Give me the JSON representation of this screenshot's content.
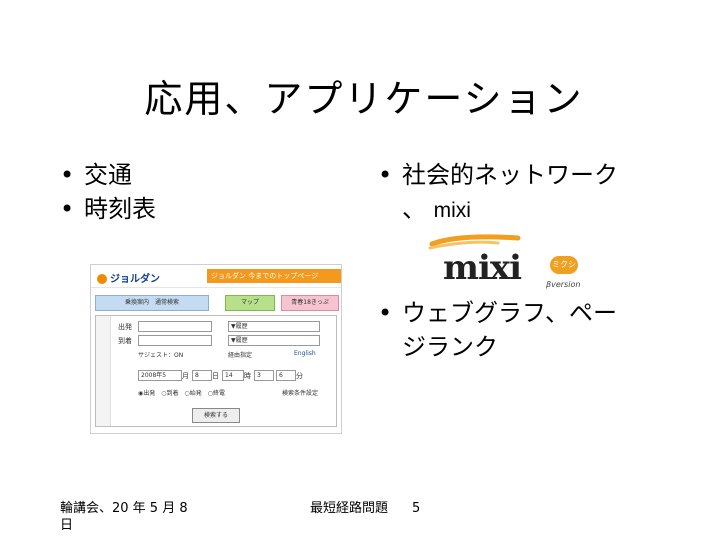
{
  "slide": {
    "title": "応用、アプリケーション",
    "left_bullets": [
      "交通",
      "時刻表"
    ],
    "right_bullets": {
      "first_line1": "社会的ネットワーク",
      "first_line2_prefix": "、",
      "first_line2_mixi": "mixi",
      "second_line1": "ウェブグラフ、ペー",
      "second_line2": "ジランク"
    }
  },
  "jorudan_screenshot": {
    "logo_text": "ジョルダン",
    "banner_text": "ジョルダン  今までのトップページ",
    "tabs": [
      "乗換案内　通常検索",
      "マップ",
      "青春18きっぷ"
    ],
    "from_label": "出発",
    "to_label": "到着",
    "station_select": "▼履歴",
    "suggest": "サジェスト：ON",
    "english_link": "English",
    "transit_link": "経由指定",
    "date_value": "2008年5",
    "month_value": "8",
    "day_value": "14",
    "hour_value": "3",
    "minute_value": "6",
    "date_unit_month": "月",
    "date_unit_day": "日",
    "date_unit_hour": "時",
    "date_unit_min": "分",
    "radio_options": "◉出発　○到着　○始発　○終電",
    "search_button": "検索する",
    "settings_link": "検索条件設定"
  },
  "mixi_logo": {
    "word": "mixi",
    "badge": "ミクシィ",
    "version": "βversion"
  },
  "footer": {
    "date": "輪講会、20 年 5 月 8 日",
    "topic": "最短経路問題",
    "page": "5"
  }
}
